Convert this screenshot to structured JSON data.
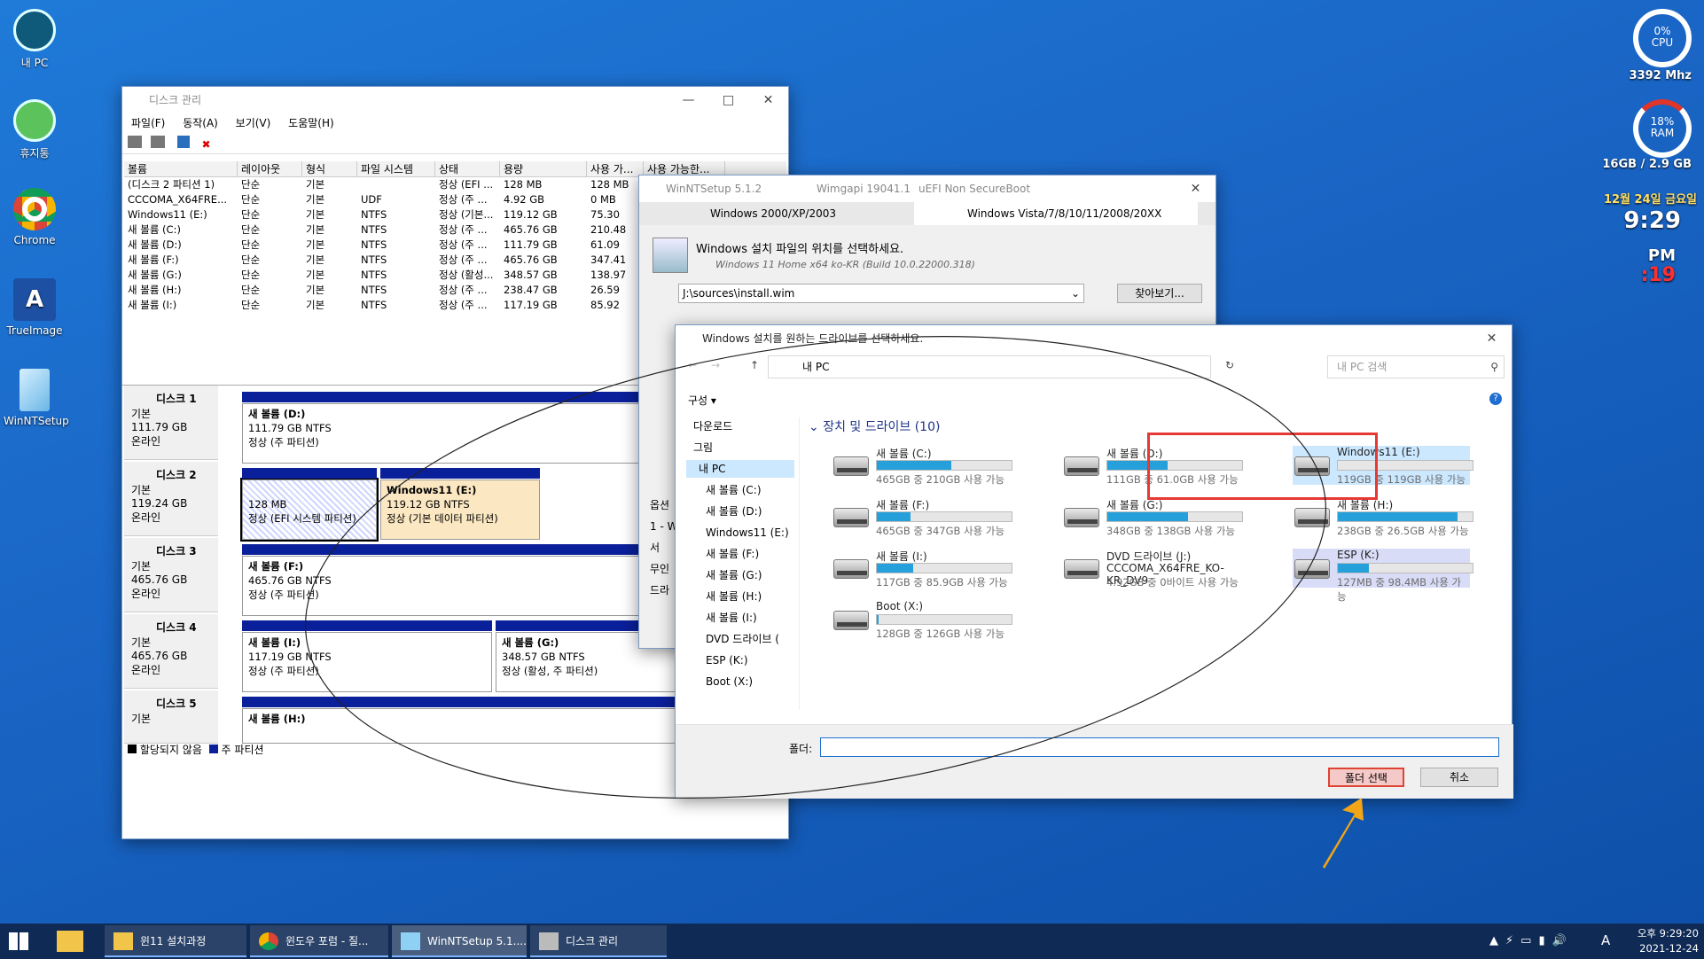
{
  "desktop": {
    "icons": [
      {
        "label": "내 PC"
      },
      {
        "label": "휴지통"
      },
      {
        "label": "Chrome"
      },
      {
        "label": "TrueImage"
      },
      {
        "label": "WinNTSetup"
      }
    ]
  },
  "gadgets": {
    "cpu_percent": "0%",
    "cpu_label": "CPU",
    "cpu_freq": "3392 Mhz",
    "ram_percent": "18%",
    "ram_label": "RAM",
    "ram_usage": "16GB / 2.9 GB",
    "date": "12월 24일 금요일",
    "time": "9:29",
    "ampm": "PM",
    "seconds": ":19"
  },
  "disk_mgmt": {
    "title": "디스크 관리",
    "menu": [
      "파일(F)",
      "동작(A)",
      "보기(V)",
      "도움말(H)"
    ],
    "columns": [
      "볼륨",
      "레이아웃",
      "형식",
      "파일 시스템",
      "상태",
      "용량",
      "사용 가...",
      "사용 가능한..."
    ],
    "rows": [
      [
        "(디스크 2 파티션 1)",
        "단순",
        "기본",
        "",
        "정상 (EFI ...",
        "128 MB",
        "128 MB"
      ],
      [
        "CCCOMA_X64FRE...",
        "단순",
        "기본",
        "UDF",
        "정상 (주 ...",
        "4.92 GB",
        "0 MB"
      ],
      [
        "Windows11 (E:)",
        "단순",
        "기본",
        "NTFS",
        "정상 (기본...",
        "119.12 GB",
        "75.30"
      ],
      [
        "새 볼륨 (C:)",
        "단순",
        "기본",
        "NTFS",
        "정상 (주 ...",
        "465.76 GB",
        "210.48"
      ],
      [
        "새 볼륨 (D:)",
        "단순",
        "기본",
        "NTFS",
        "정상 (주 ...",
        "111.79 GB",
        "61.09"
      ],
      [
        "새 볼륨 (F:)",
        "단순",
        "기본",
        "NTFS",
        "정상 (주 ...",
        "465.76 GB",
        "347.41"
      ],
      [
        "새 볼륨 (G:)",
        "단순",
        "기본",
        "NTFS",
        "정상 (활성...",
        "348.57 GB",
        "138.97"
      ],
      [
        "새 볼륨 (H:)",
        "단순",
        "기본",
        "NTFS",
        "정상 (주 ...",
        "238.47 GB",
        "26.59"
      ],
      [
        "새 볼륨 (I:)",
        "단순",
        "기본",
        "NTFS",
        "정상 (주 ...",
        "117.19 GB",
        "85.92"
      ]
    ],
    "disks": [
      {
        "name": "디스크 1",
        "type": "기본",
        "size": "111.79 GB",
        "state": "온라인"
      },
      {
        "name": "디스크 2",
        "type": "기본",
        "size": "119.24 GB",
        "state": "온라인"
      },
      {
        "name": "디스크 3",
        "type": "기본",
        "size": "465.76 GB",
        "state": "온라인"
      },
      {
        "name": "디스크 4",
        "type": "기본",
        "size": "465.76 GB",
        "state": "온라인"
      },
      {
        "name": "디스크 5",
        "type": "기본"
      }
    ],
    "parts": {
      "d1": {
        "name": "새 볼륨  (D:)",
        "size": "111.79 GB NTFS",
        "status": "정상 (주 파티션)"
      },
      "d2a": {
        "size": "128 MB",
        "status": "정상 (EFI 시스템 파티션)"
      },
      "d2b": {
        "name": "Windows11  (E:)",
        "size": "119.12 GB NTFS",
        "status": "정상 (기본 데이터 파티션)"
      },
      "d3": {
        "name": "새 볼륨  (F:)",
        "size": "465.76 GB NTFS",
        "status": "정상 (주 파티션)"
      },
      "d4a": {
        "name": "새 볼륨  (I:)",
        "size": "117.19 GB NTFS",
        "status": "정상 (주 파티션)"
      },
      "d4b": {
        "name": "새 볼륨  (G:)",
        "size": "348.57 GB NTFS",
        "status": "정상 (활성, 주 파티션)"
      },
      "d5": {
        "name": "새 볼륨  (H:)"
      }
    },
    "legend_unalloc": "할당되지 않음",
    "legend_primary": "주 파티션"
  },
  "winnt": {
    "title": "WinNTSetup 5.1.2",
    "wimgapi": "Wimgapi 19041.1",
    "uefi": "uEFI Non SecureBoot",
    "tab1": "Windows 2000/XP/2003",
    "tab2": "Windows Vista/7/8/10/11/2008/20XX",
    "source_label": "Windows 설치 파일의 위치를 선택하세요.",
    "source_sub": "Windows 11 Home  x64 ko-KR (Build 10.0.22000.318)",
    "source_path": "J:\\sources\\install.wim",
    "browse": "찾아보기...",
    "opt_label": "옵션",
    "opt_value": "1 - W",
    "opt_check": "서",
    "opt_line2": "무인",
    "opt_line3": "드라"
  },
  "picker": {
    "title": "Windows 설치를 원하는 드라이브를 선택하세요.",
    "address": "내 PC",
    "search_placeholder": "내 PC 검색",
    "organize": "구성",
    "section": "장치 및 드라이브 (10)",
    "nav": [
      "다운로드",
      "그림",
      "내 PC",
      "새 볼륨 (C:)",
      "새 볼륨 (D:)",
      "Windows11 (E:)",
      "새 볼륨 (F:)",
      "새 볼륨 (G:)",
      "새 볼륨 (H:)",
      "새 볼륨 (I:)",
      "DVD 드라이브 (",
      "ESP (K:)",
      "Boot (X:)"
    ],
    "drives": [
      {
        "name": "새 볼륨 (C:)",
        "cap": "465GB 중 210GB 사용 가능",
        "used": 0.55
      },
      {
        "name": "새 볼륨 (D:)",
        "cap": "111GB 중 61.0GB 사용 가능",
        "used": 0.45
      },
      {
        "name": "Windows11 (E:)",
        "cap": "119GB 중 119GB 사용 가능",
        "used": 0.0
      },
      {
        "name": "새 볼륨 (F:)",
        "cap": "465GB 중 347GB 사용 가능",
        "used": 0.25
      },
      {
        "name": "새 볼륨 (G:)",
        "cap": "348GB 중 138GB 사용 가능",
        "used": 0.6
      },
      {
        "name": "새 볼륨 (H:)",
        "cap": "238GB 중 26.5GB 사용 가능",
        "used": 0.89
      },
      {
        "name": "새 볼륨 (I:)",
        "cap": "117GB 중 85.9GB 사용 가능",
        "used": 0.27
      },
      {
        "name": "DVD 드라이브 (J:)",
        "sub": "CCCOMA_X64FRE_KO-KR_DV9",
        "cap": "4.92GB 중 0바이트 사용 가능"
      },
      {
        "name": "ESP (K:)",
        "cap": "127MB 중 98.4MB 사용 가능",
        "used": 0.23
      },
      {
        "name": "Boot (X:)",
        "cap": "128GB 중 126GB 사용 가능",
        "used": 0.01
      }
    ],
    "folder_label": "폴더:",
    "select_btn": "폴더 선택",
    "cancel_btn": "취소"
  },
  "taskbar": {
    "items": [
      "윈11 설치과정",
      "윈도우 포럼 - 질...",
      "WinNTSetup 5.1....",
      "디스크 관리"
    ],
    "ime": "A",
    "clock_time": "오후 9:29:20",
    "clock_date": "2021-12-24"
  },
  "colors": {
    "accent": "#26a0da",
    "highlight_box": "#e53935",
    "arrow": "#f2a516",
    "partition_bar": "#0a1f9a"
  }
}
